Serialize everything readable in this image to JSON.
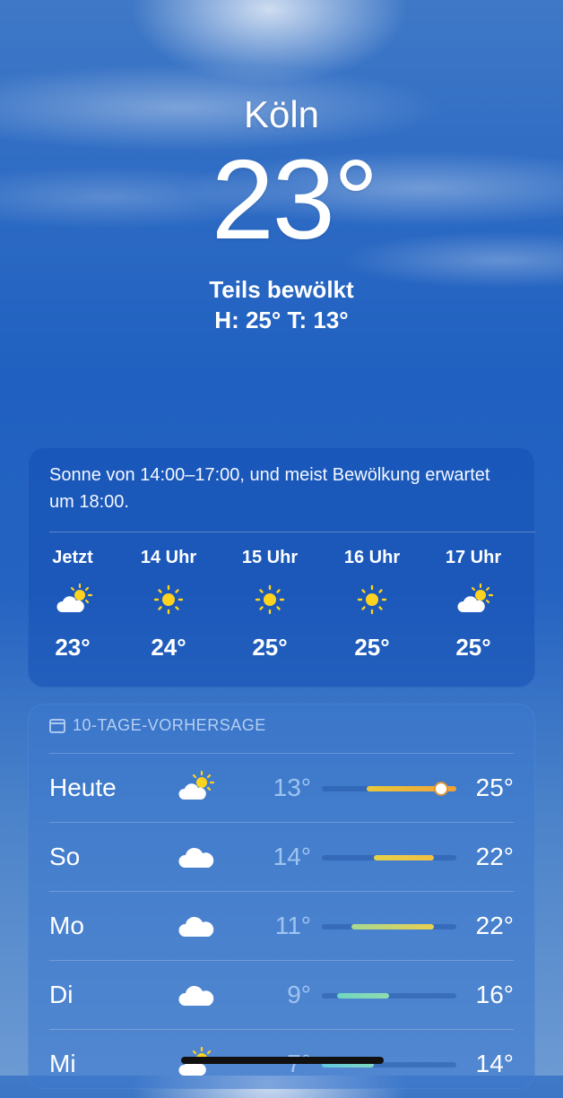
{
  "location": {
    "city": "Köln",
    "temperature": "23°",
    "condition": "Teils bewölkt",
    "high_low": "H: 25°  T: 13°"
  },
  "hourly_card": {
    "summary": "Sonne von 14:00–17:00, und meist Bewölkung erwartet um 18:00.",
    "hours": [
      {
        "label": "Jetzt",
        "icon": "partly-sunny-icon",
        "temp": "23°"
      },
      {
        "label": "14 Uhr",
        "icon": "sun-icon",
        "temp": "24°"
      },
      {
        "label": "15 Uhr",
        "icon": "sun-icon",
        "temp": "25°"
      },
      {
        "label": "16 Uhr",
        "icon": "sun-icon",
        "temp": "25°"
      },
      {
        "label": "17 Uhr",
        "icon": "partly-sunny-icon",
        "temp": "25°"
      }
    ]
  },
  "forecast_card": {
    "title": "10-TAGE-VORHERSAGE",
    "icon": "calendar-icon",
    "range_scale": {
      "min": 7,
      "max": 25
    },
    "days": [
      {
        "day": "Heute",
        "icon": "partly-sunny-icon",
        "low": "13°",
        "high": "25°",
        "low_value": 13,
        "high_value": 25,
        "current_value": 23,
        "colors": [
          "#e8c83a",
          "#f0a03a"
        ]
      },
      {
        "day": "So",
        "icon": "cloud-icon",
        "low": "14°",
        "high": "22°",
        "low_value": 14,
        "high_value": 22,
        "colors": [
          "#e6d24a",
          "#f0c040"
        ]
      },
      {
        "day": "Mo",
        "icon": "cloud-icon",
        "low": "11°",
        "high": "22°",
        "low_value": 11,
        "high_value": 22,
        "colors": [
          "#a8d890",
          "#e8d050"
        ]
      },
      {
        "day": "Di",
        "icon": "cloud-icon",
        "low": "9°",
        "high": "16°",
        "low_value": 9,
        "high_value": 16,
        "colors": [
          "#6fd6c0",
          "#90dcb0"
        ]
      },
      {
        "day": "Mi",
        "icon": "partly-sunny-icon",
        "low": "7°",
        "high": "14°",
        "low_value": 7,
        "high_value": 14,
        "colors": [
          "#60c8e0",
          "#80d8c0"
        ]
      }
    ]
  },
  "colors": {
    "sun": "#ffd21f",
    "cloud": "#ffffff",
    "low_temp_text": "#9ec4f0"
  }
}
